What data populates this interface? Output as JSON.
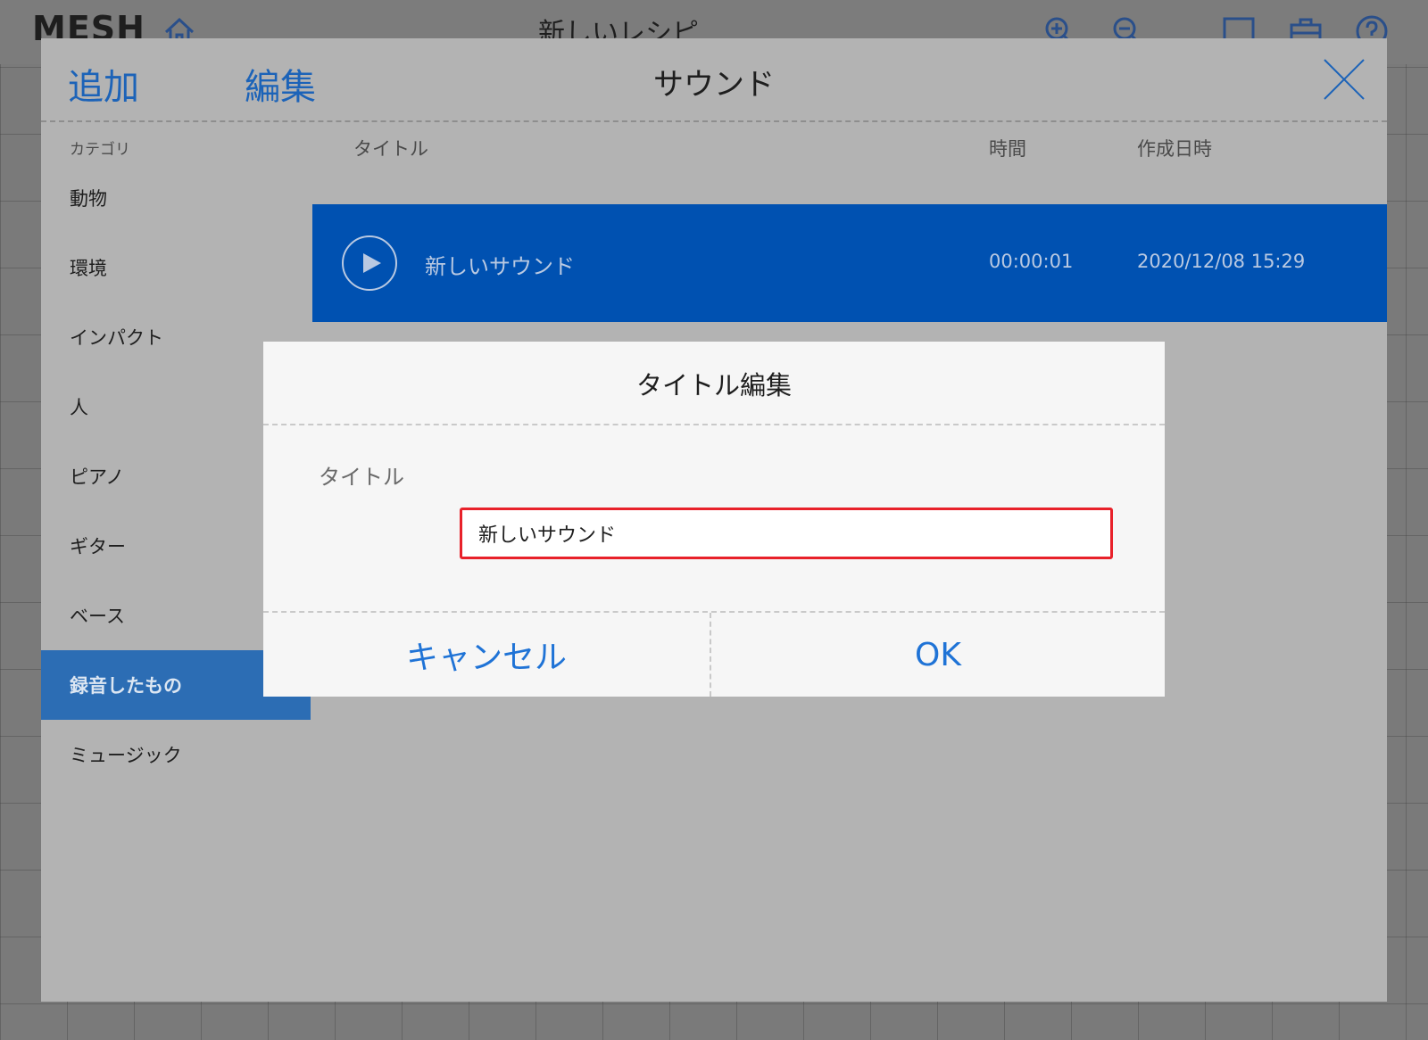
{
  "app": {
    "logo": "MESH",
    "recipe_title": "新しいレシピ"
  },
  "modal": {
    "tabs": {
      "add": "追加",
      "edit": "編集"
    },
    "title": "サウンド",
    "category_label": "カテゴリ",
    "categories": [
      {
        "label": "動物"
      },
      {
        "label": "環境"
      },
      {
        "label": "インパクト"
      },
      {
        "label": "人"
      },
      {
        "label": "ピアノ"
      },
      {
        "label": "ギター"
      },
      {
        "label": "ベース"
      },
      {
        "label": "録音したもの",
        "selected": true
      },
      {
        "label": "ミュージック"
      }
    ],
    "columns": {
      "title": "タイトル",
      "duration": "時間",
      "created": "作成日時"
    },
    "sounds": [
      {
        "title": "新しいサウンド",
        "duration": "00:00:01",
        "created": "2020/12/08 15:29",
        "selected": true
      }
    ]
  },
  "dialog": {
    "title": "タイトル編集",
    "field_label": "タイトル",
    "input_value": "新しいサウンド",
    "cancel_label": "キャンセル",
    "ok_label": "OK"
  },
  "icons": {
    "home": "home-icon",
    "zoom_in": "zoom-in-icon",
    "zoom_out": "zoom-out-icon",
    "window": "window-icon",
    "toolbox": "toolbox-icon",
    "help": "help-icon",
    "close": "close-icon",
    "play": "play-icon"
  },
  "colors": {
    "accent_blue": "#1c63b8",
    "selected_row": "#0051b1",
    "selected_category": "#2c6db4",
    "input_highlight": "#e8212a"
  }
}
